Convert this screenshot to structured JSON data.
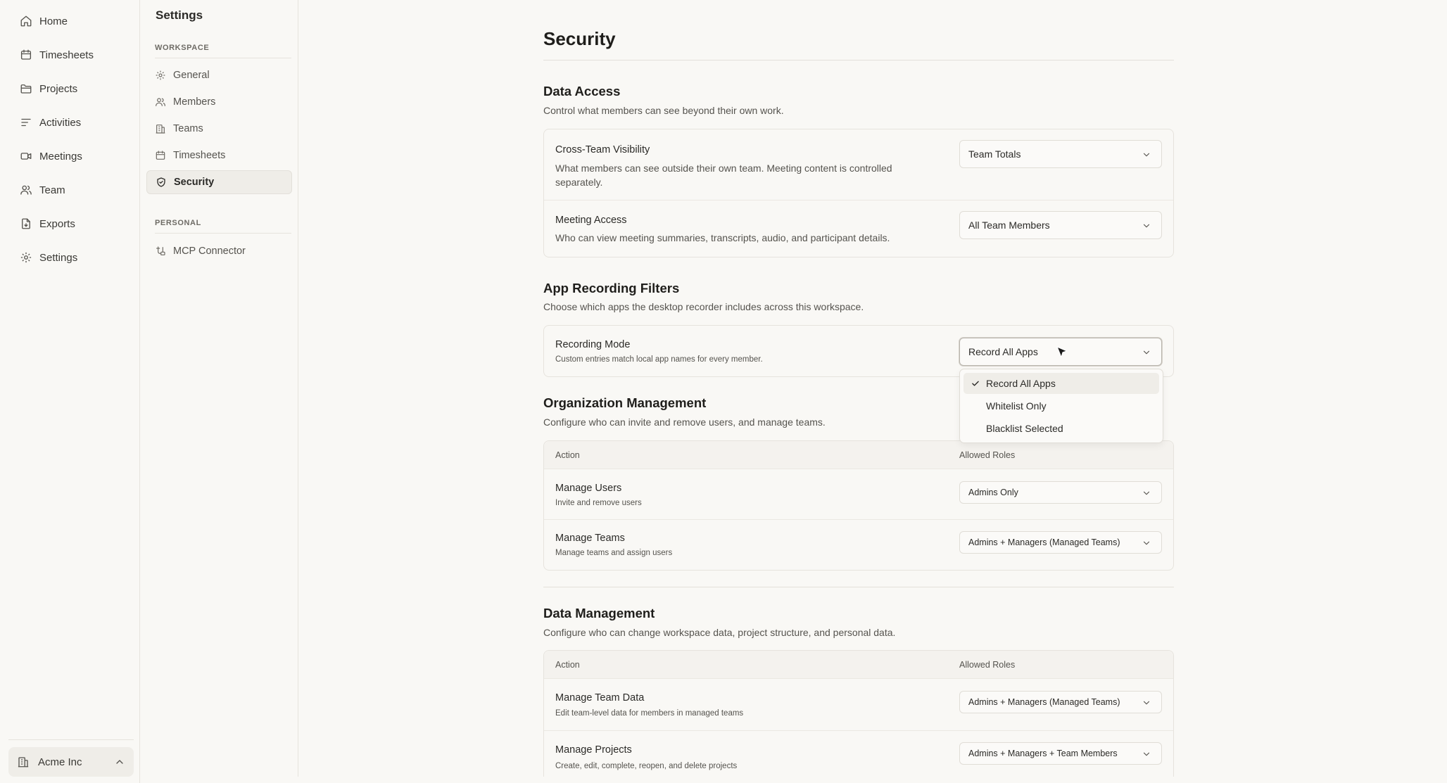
{
  "nav": {
    "items": [
      {
        "label": "Home",
        "icon": "home-icon"
      },
      {
        "label": "Timesheets",
        "icon": "calendar-icon"
      },
      {
        "label": "Projects",
        "icon": "folder-icon"
      },
      {
        "label": "Activities",
        "icon": "activity-lines-icon"
      },
      {
        "label": "Meetings",
        "icon": "video-icon"
      },
      {
        "label": "Team",
        "icon": "users-icon"
      },
      {
        "label": "Exports",
        "icon": "file-export-icon"
      },
      {
        "label": "Settings",
        "icon": "gear-icon"
      }
    ],
    "workspace_name": "Acme Inc"
  },
  "settings_nav": {
    "title": "Settings",
    "workspace_section": "WORKSPACE",
    "workspace_items": [
      {
        "label": "General",
        "icon": "gear-icon"
      },
      {
        "label": "Members",
        "icon": "users-icon"
      },
      {
        "label": "Teams",
        "icon": "building-icon"
      },
      {
        "label": "Timesheets",
        "icon": "calendar-icon"
      },
      {
        "label": "Security",
        "icon": "shield-icon",
        "active": true
      }
    ],
    "personal_section": "PERSONAL",
    "personal_items": [
      {
        "label": "MCP Connector",
        "icon": "connector-icon"
      }
    ]
  },
  "page": {
    "title": "Security",
    "data_access": {
      "title": "Data Access",
      "description": "Control what members can see beyond their own work.",
      "rows": [
        {
          "title": "Cross-Team Visibility",
          "description": "What members can see outside their own team. Meeting content is controlled separately.",
          "value": "Team Totals"
        },
        {
          "title": "Meeting Access",
          "description": "Who can view meeting summaries, transcripts, audio, and participant details.",
          "value": "All Team Members"
        }
      ]
    },
    "app_recording": {
      "title": "App Recording Filters",
      "description": "Choose which apps the desktop recorder includes across this workspace.",
      "row": {
        "title": "Recording Mode",
        "description": "Custom entries match local app names for every member.",
        "value": "Record All Apps"
      },
      "options": [
        {
          "label": "Record All Apps",
          "selected": true
        },
        {
          "label": "Whitelist Only",
          "selected": false
        },
        {
          "label": "Blacklist Selected",
          "selected": false
        }
      ]
    },
    "org_management": {
      "title": "Organization Management",
      "description": "Configure who can invite and remove users, and manage teams.",
      "col_action": "Action",
      "col_roles": "Allowed Roles",
      "rows": [
        {
          "title": "Manage Users",
          "description": "Invite and remove users",
          "value": "Admins Only"
        },
        {
          "title": "Manage Teams",
          "description": "Manage teams and assign users",
          "value": "Admins + Managers (Managed Teams)"
        }
      ]
    },
    "data_management": {
      "title": "Data Management",
      "description": "Configure who can change workspace data, project structure, and personal data.",
      "col_action": "Action",
      "col_roles": "Allowed Roles",
      "rows": [
        {
          "title": "Manage Team Data",
          "description": "Edit team-level data for members in managed teams",
          "value": "Admins + Managers (Managed Teams)"
        },
        {
          "title": "Manage Projects",
          "description": "Create, edit, complete, reopen, and delete projects",
          "value": "Admins + Managers + Team Members"
        }
      ]
    }
  }
}
